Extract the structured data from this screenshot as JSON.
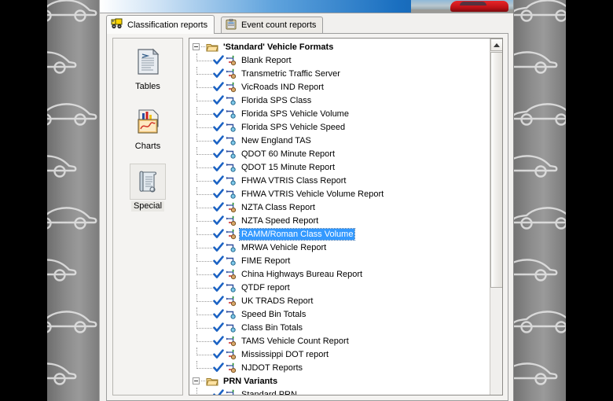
{
  "window": {
    "title": "Classification reports"
  },
  "banner": {
    "icon": "highway-photo-banner"
  },
  "tabs": [
    {
      "id": "classification",
      "label": "Classification reports",
      "icon": "truck-icon",
      "active": true
    },
    {
      "id": "eventcount",
      "label": "Event count reports",
      "icon": "clipboard-icon",
      "active": false
    }
  ],
  "iconbar": {
    "items": [
      {
        "id": "tables",
        "label": "Tables",
        "icon": "document-pages-icon",
        "selected": false
      },
      {
        "id": "charts",
        "label": "Charts",
        "icon": "bar-chart-icon",
        "selected": false
      },
      {
        "id": "special",
        "label": "Special",
        "icon": "scroll-icon",
        "selected": true
      }
    ]
  },
  "tree": {
    "groups": [
      {
        "id": "standard-vehicle-formats",
        "label": "'Standard' Vehicle Formats",
        "expanded": true,
        "icon": "folder-open-icon",
        "items": [
          {
            "label": "Blank Report",
            "icon": "axle-node-icon",
            "checked": true,
            "selected": false
          },
          {
            "label": "Transmetric Traffic Server",
            "icon": "axle-node-icon",
            "checked": true,
            "selected": false
          },
          {
            "label": "VicRoads IND Report",
            "icon": "axle-node-icon",
            "checked": true,
            "selected": false
          },
          {
            "label": "Florida SPS Class",
            "icon": "simple-node-icon",
            "checked": true,
            "selected": false
          },
          {
            "label": "Florida SPS Vehicle Volume",
            "icon": "simple-node-icon",
            "checked": true,
            "selected": false
          },
          {
            "label": "Florida SPS Vehicle Speed",
            "icon": "simple-node-icon",
            "checked": true,
            "selected": false
          },
          {
            "label": "New England TAS",
            "icon": "simple-node-icon",
            "checked": true,
            "selected": false
          },
          {
            "label": "QDOT 60 Minute Report",
            "icon": "simple-node-icon",
            "checked": true,
            "selected": false
          },
          {
            "label": "QDOT 15 Minute Report",
            "icon": "simple-node-icon",
            "checked": true,
            "selected": false
          },
          {
            "label": "FHWA VTRIS Class Report",
            "icon": "simple-node-icon",
            "checked": true,
            "selected": false
          },
          {
            "label": "FHWA VTRIS Vehicle Volume Report",
            "icon": "simple-node-icon",
            "checked": true,
            "selected": false
          },
          {
            "label": "NZTA Class Report",
            "icon": "axle-node-icon",
            "checked": true,
            "selected": false
          },
          {
            "label": "NZTA Speed Report",
            "icon": "axle-node-icon",
            "checked": true,
            "selected": false
          },
          {
            "label": "RAMM/Roman Class Volume",
            "icon": "axle-node-icon",
            "checked": true,
            "selected": true
          },
          {
            "label": "MRWA Vehicle Report",
            "icon": "simple-node-icon",
            "checked": true,
            "selected": false
          },
          {
            "label": "FIME Report",
            "icon": "simple-node-icon",
            "checked": true,
            "selected": false
          },
          {
            "label": "China Highways Bureau Report",
            "icon": "axle-node-icon",
            "checked": true,
            "selected": false
          },
          {
            "label": "QTDF report",
            "icon": "simple-node-icon",
            "checked": true,
            "selected": false
          },
          {
            "label": "UK TRADS Report",
            "icon": "axle-node-icon",
            "checked": true,
            "selected": false
          },
          {
            "label": "Speed Bin Totals",
            "icon": "simple-node-icon",
            "checked": true,
            "selected": false
          },
          {
            "label": "Class Bin Totals",
            "icon": "simple-node-icon",
            "checked": true,
            "selected": false
          },
          {
            "label": "TAMS Vehicle Count Report",
            "icon": "axle-node-icon",
            "checked": true,
            "selected": false
          },
          {
            "label": "Mississippi DOT report",
            "icon": "axle-node-icon",
            "checked": true,
            "selected": false
          },
          {
            "label": "NJDOT Reports",
            "icon": "axle-node-icon",
            "checked": true,
            "selected": false
          }
        ]
      },
      {
        "id": "prn-variants",
        "label": "PRN Variants",
        "expanded": true,
        "icon": "folder-open-icon",
        "items": [
          {
            "label": "Standard PRN",
            "icon": "axle-node-icon",
            "checked": true,
            "selected": false
          }
        ]
      }
    ]
  },
  "scrollbar": {
    "up_arrow": "scroll-up-arrow",
    "position_percent": 0
  },
  "colors": {
    "selection_blue": "#3399ff",
    "tab_active_bg": "#fbfbfa",
    "panel_bg": "#f4f3f1",
    "tree_bg": "#ffffff",
    "banner_blue": "#1a6fc0"
  }
}
